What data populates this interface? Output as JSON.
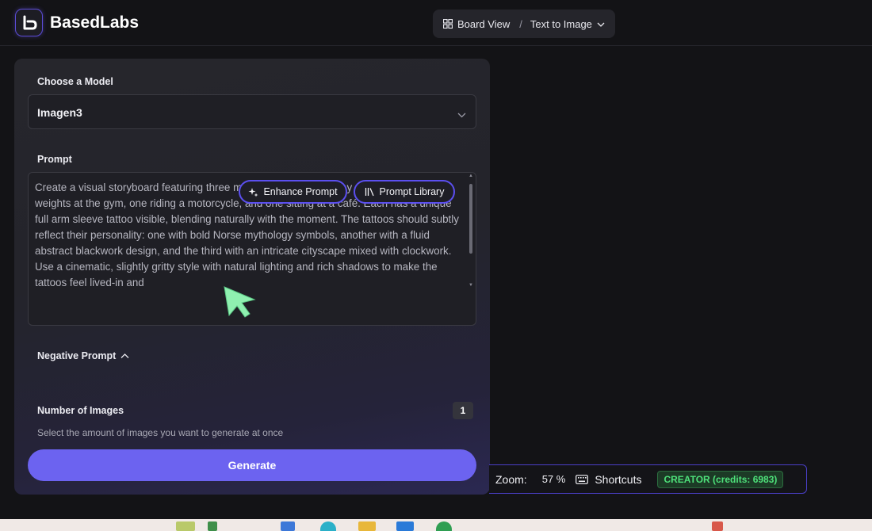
{
  "app": {
    "brand": "BasedLabs"
  },
  "breadcrumb": {
    "board_view": "Board View",
    "separator": "/",
    "current": "Text to Image"
  },
  "model": {
    "label": "Choose a Model",
    "selected": "Imagen3"
  },
  "prompt": {
    "label": "Prompt",
    "value": "Create a visual storyboard featuring three men in different everyday settings—one lifting weights at the gym, one riding a motorcycle, and one sitting at a café. Each has a unique full arm sleeve tattoo visible, blending naturally with the moment. The tattoos should subtly reflect their personality: one with bold Norse mythology symbols, another with a fluid abstract blackwork design, and the third with an intricate cityscape mixed with clockwork. Use a cinematic, slightly gritty style with natural lighting and rich shadows to make the tattoos feel lived-in and",
    "enhance_label": "Enhance Prompt",
    "library_label": "Prompt Library"
  },
  "negative_prompt": {
    "label": "Negative Prompt"
  },
  "number_of_images": {
    "label": "Number of Images",
    "value": "1",
    "helper": "Select the amount of images you want to generate at once"
  },
  "generate_label": "Generate",
  "statusbar": {
    "zoom_label": "Zoom:",
    "zoom_value": "57 %",
    "shortcuts_label": "Shortcuts",
    "credits_badge": "CREATOR (credits: 6983)"
  },
  "colors": {
    "accent": "#6c63f0",
    "pill_border": "#5b4ff0",
    "credits_text": "#4ee07a",
    "cursor": "#8ff0b0"
  },
  "icons": {
    "logo": "basedlabs-logo-icon",
    "board": "grid-icon",
    "chevron": "chevron-down-icon",
    "enhance": "sparkle-icon",
    "library": "books-icon",
    "negative_toggle": "chevron-up-icon",
    "shortcuts": "keyboard-icon",
    "cursor": "pointer-cursor-icon"
  }
}
